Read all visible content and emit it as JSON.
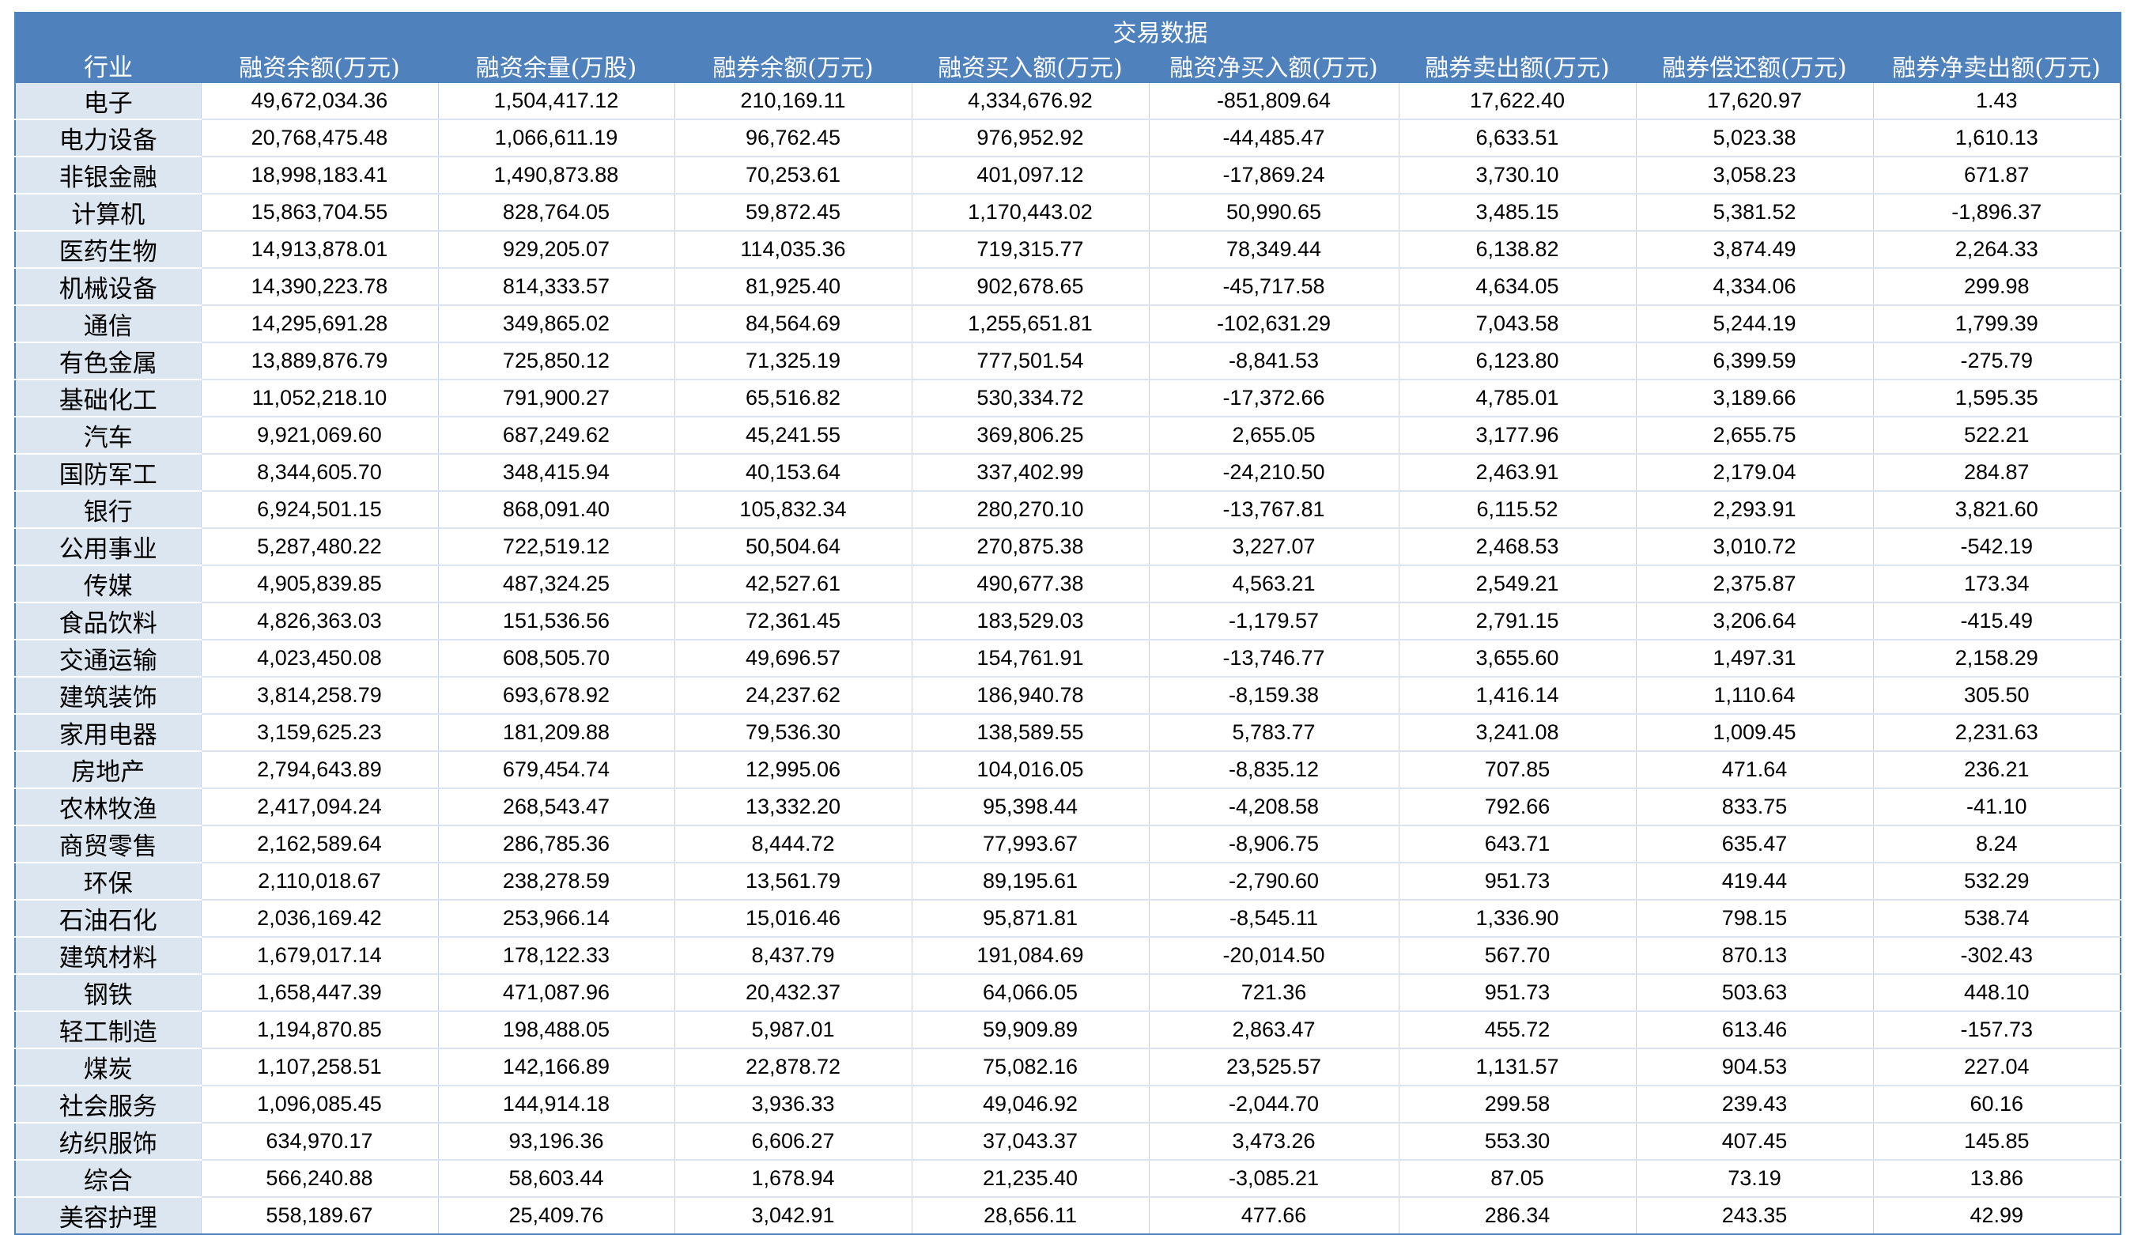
{
  "table": {
    "industry_header": "行业",
    "group_header": "交易数据",
    "columns": [
      "融资余额(万元)",
      "融资余量(万股)",
      "融券余额(万元)",
      "融资买入额(万元)",
      "融资净买入额(万元)",
      "融券卖出额(万元)",
      "融券偿还额(万元)",
      "融券净卖出额(万元)"
    ],
    "rows": [
      {
        "industry": "电子",
        "values": [
          "49,672,034.36",
          "1,504,417.12",
          "210,169.11",
          "4,334,676.92",
          "-851,809.64",
          "17,622.40",
          "17,620.97",
          "1.43"
        ]
      },
      {
        "industry": "电力设备",
        "values": [
          "20,768,475.48",
          "1,066,611.19",
          "96,762.45",
          "976,952.92",
          "-44,485.47",
          "6,633.51",
          "5,023.38",
          "1,610.13"
        ]
      },
      {
        "industry": "非银金融",
        "values": [
          "18,998,183.41",
          "1,490,873.88",
          "70,253.61",
          "401,097.12",
          "-17,869.24",
          "3,730.10",
          "3,058.23",
          "671.87"
        ]
      },
      {
        "industry": "计算机",
        "values": [
          "15,863,704.55",
          "828,764.05",
          "59,872.45",
          "1,170,443.02",
          "50,990.65",
          "3,485.15",
          "5,381.52",
          "-1,896.37"
        ]
      },
      {
        "industry": "医药生物",
        "values": [
          "14,913,878.01",
          "929,205.07",
          "114,035.36",
          "719,315.77",
          "78,349.44",
          "6,138.82",
          "3,874.49",
          "2,264.33"
        ]
      },
      {
        "industry": "机械设备",
        "values": [
          "14,390,223.78",
          "814,333.57",
          "81,925.40",
          "902,678.65",
          "-45,717.58",
          "4,634.05",
          "4,334.06",
          "299.98"
        ]
      },
      {
        "industry": "通信",
        "values": [
          "14,295,691.28",
          "349,865.02",
          "84,564.69",
          "1,255,651.81",
          "-102,631.29",
          "7,043.58",
          "5,244.19",
          "1,799.39"
        ]
      },
      {
        "industry": "有色金属",
        "values": [
          "13,889,876.79",
          "725,850.12",
          "71,325.19",
          "777,501.54",
          "-8,841.53",
          "6,123.80",
          "6,399.59",
          "-275.79"
        ]
      },
      {
        "industry": "基础化工",
        "values": [
          "11,052,218.10",
          "791,900.27",
          "65,516.82",
          "530,334.72",
          "-17,372.66",
          "4,785.01",
          "3,189.66",
          "1,595.35"
        ]
      },
      {
        "industry": "汽车",
        "values": [
          "9,921,069.60",
          "687,249.62",
          "45,241.55",
          "369,806.25",
          "2,655.05",
          "3,177.96",
          "2,655.75",
          "522.21"
        ]
      },
      {
        "industry": "国防军工",
        "values": [
          "8,344,605.70",
          "348,415.94",
          "40,153.64",
          "337,402.99",
          "-24,210.50",
          "2,463.91",
          "2,179.04",
          "284.87"
        ]
      },
      {
        "industry": "银行",
        "values": [
          "6,924,501.15",
          "868,091.40",
          "105,832.34",
          "280,270.10",
          "-13,767.81",
          "6,115.52",
          "2,293.91",
          "3,821.60"
        ]
      },
      {
        "industry": "公用事业",
        "values": [
          "5,287,480.22",
          "722,519.12",
          "50,504.64",
          "270,875.38",
          "3,227.07",
          "2,468.53",
          "3,010.72",
          "-542.19"
        ]
      },
      {
        "industry": "传媒",
        "values": [
          "4,905,839.85",
          "487,324.25",
          "42,527.61",
          "490,677.38",
          "4,563.21",
          "2,549.21",
          "2,375.87",
          "173.34"
        ]
      },
      {
        "industry": "食品饮料",
        "values": [
          "4,826,363.03",
          "151,536.56",
          "72,361.45",
          "183,529.03",
          "-1,179.57",
          "2,791.15",
          "3,206.64",
          "-415.49"
        ]
      },
      {
        "industry": "交通运输",
        "values": [
          "4,023,450.08",
          "608,505.70",
          "49,696.57",
          "154,761.91",
          "-13,746.77",
          "3,655.60",
          "1,497.31",
          "2,158.29"
        ]
      },
      {
        "industry": "建筑装饰",
        "values": [
          "3,814,258.79",
          "693,678.92",
          "24,237.62",
          "186,940.78",
          "-8,159.38",
          "1,416.14",
          "1,110.64",
          "305.50"
        ]
      },
      {
        "industry": "家用电器",
        "values": [
          "3,159,625.23",
          "181,209.88",
          "79,536.30",
          "138,589.55",
          "5,783.77",
          "3,241.08",
          "1,009.45",
          "2,231.63"
        ]
      },
      {
        "industry": "房地产",
        "values": [
          "2,794,643.89",
          "679,454.74",
          "12,995.06",
          "104,016.05",
          "-8,835.12",
          "707.85",
          "471.64",
          "236.21"
        ]
      },
      {
        "industry": "农林牧渔",
        "values": [
          "2,417,094.24",
          "268,543.47",
          "13,332.20",
          "95,398.44",
          "-4,208.58",
          "792.66",
          "833.75",
          "-41.10"
        ]
      },
      {
        "industry": "商贸零售",
        "values": [
          "2,162,589.64",
          "286,785.36",
          "8,444.72",
          "77,993.67",
          "-8,906.75",
          "643.71",
          "635.47",
          "8.24"
        ]
      },
      {
        "industry": "环保",
        "values": [
          "2,110,018.67",
          "238,278.59",
          "13,561.79",
          "89,195.61",
          "-2,790.60",
          "951.73",
          "419.44",
          "532.29"
        ]
      },
      {
        "industry": "石油石化",
        "values": [
          "2,036,169.42",
          "253,966.14",
          "15,016.46",
          "95,871.81",
          "-8,545.11",
          "1,336.90",
          "798.15",
          "538.74"
        ]
      },
      {
        "industry": "建筑材料",
        "values": [
          "1,679,017.14",
          "178,122.33",
          "8,437.79",
          "191,084.69",
          "-20,014.50",
          "567.70",
          "870.13",
          "-302.43"
        ]
      },
      {
        "industry": "钢铁",
        "values": [
          "1,658,447.39",
          "471,087.96",
          "20,432.37",
          "64,066.05",
          "721.36",
          "951.73",
          "503.63",
          "448.10"
        ]
      },
      {
        "industry": "轻工制造",
        "values": [
          "1,194,870.85",
          "198,488.05",
          "5,987.01",
          "59,909.89",
          "2,863.47",
          "455.72",
          "613.46",
          "-157.73"
        ]
      },
      {
        "industry": "煤炭",
        "values": [
          "1,107,258.51",
          "142,166.89",
          "22,878.72",
          "75,082.16",
          "23,525.57",
          "1,131.57",
          "904.53",
          "227.04"
        ]
      },
      {
        "industry": "社会服务",
        "values": [
          "1,096,085.45",
          "144,914.18",
          "3,936.33",
          "49,046.92",
          "-2,044.70",
          "299.58",
          "239.43",
          "60.16"
        ]
      },
      {
        "industry": "纺织服饰",
        "values": [
          "634,970.17",
          "93,196.36",
          "6,606.27",
          "37,043.37",
          "3,473.26",
          "553.30",
          "407.45",
          "145.85"
        ]
      },
      {
        "industry": "综合",
        "values": [
          "566,240.88",
          "58,603.44",
          "1,678.94",
          "21,235.40",
          "-3,085.21",
          "87.05",
          "73.19",
          "13.86"
        ]
      },
      {
        "industry": "美容护理",
        "values": [
          "558,189.67",
          "25,409.76",
          "3,042.91",
          "28,656.11",
          "477.66",
          "286.34",
          "243.35",
          "42.99"
        ]
      }
    ]
  },
  "colors": {
    "header_background": "#4f81bd",
    "header_text": "#ffffff",
    "industry_column_background": "#dce6f1",
    "cell_text": "#000000"
  }
}
